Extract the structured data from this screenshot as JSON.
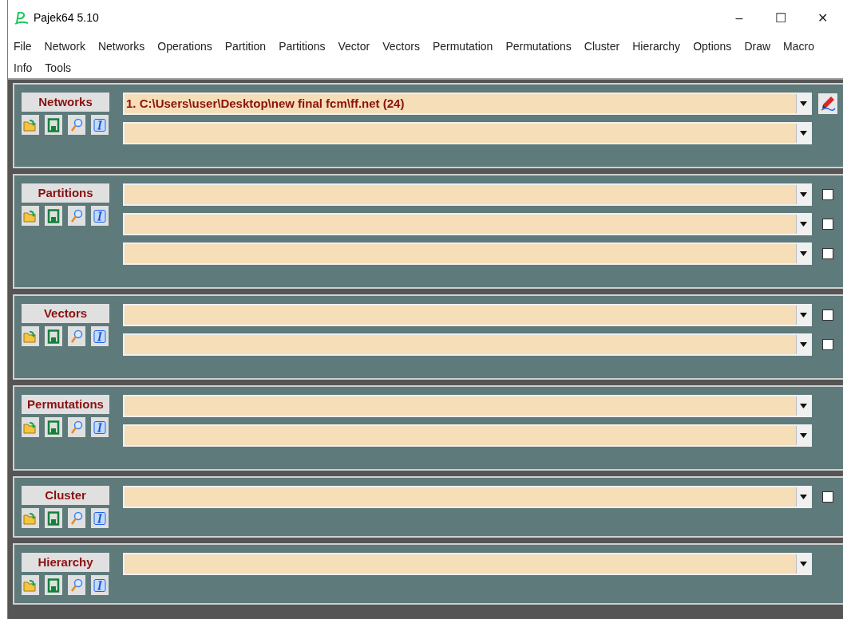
{
  "window": {
    "title": "Pajek64 5.10",
    "controls": [
      "–",
      "☐",
      "✕"
    ]
  },
  "menu": [
    "File",
    "Network",
    "Networks",
    "Operations",
    "Partition",
    "Partitions",
    "Vector",
    "Vectors",
    "Permutation",
    "Permutations",
    "Cluster",
    "Hierarchy",
    "Options",
    "Draw",
    "Macro",
    "Info",
    "Tools"
  ],
  "sections": [
    {
      "title": "Networks",
      "combos": [
        {
          "kind": "edit",
          "value": "1. C:\\Users\\user\\Desktop\\new final fcm\\ff.net (24)"
        },
        {
          "kind": "plain"
        }
      ]
    },
    {
      "title": "Partitions",
      "combos": [
        {
          "kind": "checkbox",
          "checked": false
        },
        {
          "kind": "checkbox",
          "checked": false
        },
        {
          "kind": "checkbox",
          "checked": false
        }
      ]
    },
    {
      "title": "Vectors",
      "combos": [
        {
          "kind": "checkbox",
          "checked": false
        },
        {
          "kind": "checkbox",
          "checked": false
        }
      ]
    },
    {
      "title": "Permutations",
      "combos": [
        {
          "kind": "plain"
        },
        {
          "kind": "plain"
        }
      ]
    },
    {
      "title": "Cluster",
      "combos": [
        {
          "kind": "checkbox",
          "checked": false
        }
      ]
    },
    {
      "title": "Hierarchy",
      "combos": [
        {
          "kind": "plain"
        }
      ]
    }
  ]
}
